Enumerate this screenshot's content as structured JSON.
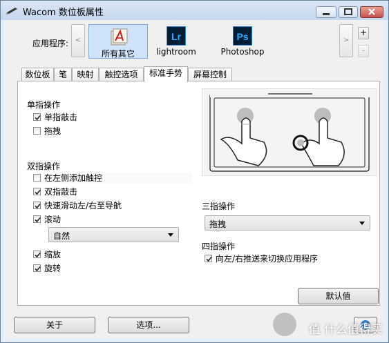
{
  "window": {
    "title": "Wacom 数位板属性"
  },
  "apps": {
    "label": "应用程序:",
    "items": [
      {
        "name": "所有其它",
        "selected": true
      },
      {
        "name": "lightroom",
        "icon_text": "Lr",
        "icon_color": "#31A8FF"
      },
      {
        "name": "Photoshop",
        "icon_text": "Ps",
        "icon_color": "#31A8FF"
      }
    ],
    "prev": "<",
    "next": ">",
    "add": "+",
    "remove": "-"
  },
  "tabs": [
    "数位板",
    "笔",
    "映射",
    "触控选项",
    "标准手势",
    "屏幕控制"
  ],
  "active_tab": "标准手势",
  "single": {
    "header": "单指操作",
    "items": [
      {
        "label": "单指敲击",
        "checked": true
      },
      {
        "label": "拖拽",
        "checked": false
      }
    ]
  },
  "double": {
    "header": "双指操作",
    "items": [
      {
        "label": "在左侧添加触控",
        "checked": false
      },
      {
        "label": "双指敲击",
        "checked": true
      },
      {
        "label": "快速滑动左/右至导航",
        "checked": true
      },
      {
        "label": "滚动",
        "checked": true
      }
    ],
    "scroll_mode": "自然",
    "items2": [
      {
        "label": "缩放",
        "checked": true
      },
      {
        "label": "旋转",
        "checked": true
      }
    ]
  },
  "three": {
    "header": "三指操作",
    "value": "拖拽"
  },
  "four": {
    "header": "四指操作",
    "item": {
      "label": "向左/右推送来切换应用程序",
      "checked": true
    }
  },
  "buttons": {
    "default": "默认值",
    "about": "关于",
    "options": "选项..."
  },
  "watermark": "值 什么值得买"
}
